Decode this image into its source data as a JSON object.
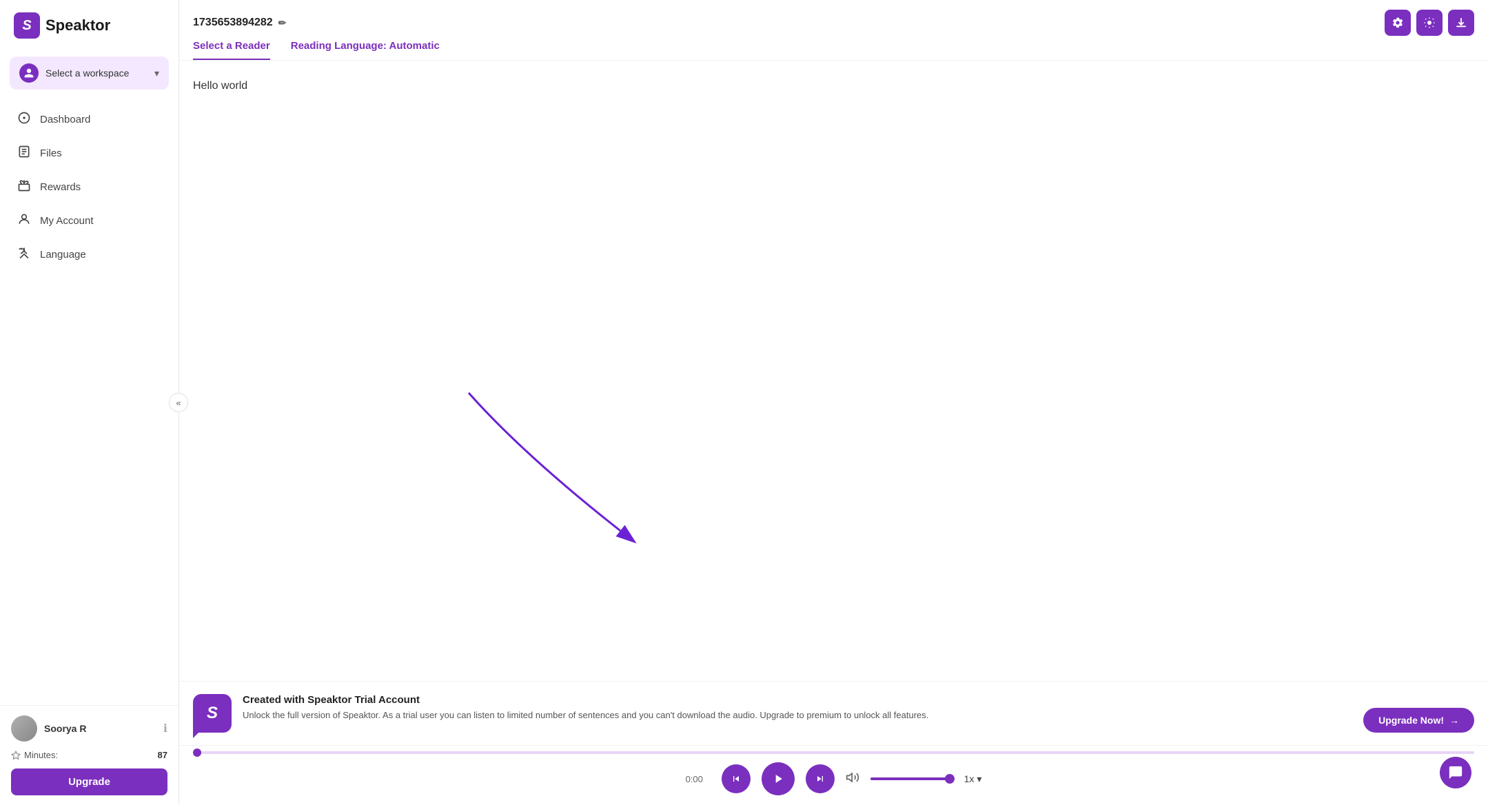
{
  "app": {
    "name": "Speaktor",
    "logo_letter": "S"
  },
  "sidebar": {
    "workspace": {
      "label": "Select a workspace",
      "chevron": "▾"
    },
    "nav": [
      {
        "id": "dashboard",
        "label": "Dashboard",
        "icon": "○"
      },
      {
        "id": "files",
        "label": "Files",
        "icon": "▦"
      },
      {
        "id": "rewards",
        "label": "Rewards",
        "icon": "⬛"
      },
      {
        "id": "my-account",
        "label": "My Account",
        "icon": "👤"
      },
      {
        "id": "language",
        "label": "Language",
        "icon": "✦"
      }
    ],
    "collapse_icon": "«",
    "user": {
      "name": "Soorya R",
      "info_icon": "ℹ",
      "minutes_label": "Minutes:",
      "minutes_value": "87",
      "upgrade_label": "Upgrade"
    }
  },
  "header": {
    "file_id": "1735653894282",
    "edit_icon": "✏",
    "tabs": [
      {
        "id": "select-reader",
        "label": "Select a Reader"
      },
      {
        "id": "reading-language",
        "label": "Reading Language: Automatic"
      }
    ],
    "actions": {
      "settings_icon": "⚙",
      "brightness_icon": "☀",
      "download_icon": "⬇"
    }
  },
  "content": {
    "text": "Hello world"
  },
  "trial": {
    "title": "Created with Speaktor Trial Account",
    "description": "Unlock the full version of Speaktor. As a trial user you can listen to limited number of sentences and you can't download the audio. Upgrade to premium to unlock all features.",
    "upgrade_label": "Upgrade Now!",
    "upgrade_icon": "→"
  },
  "player": {
    "time": "0:00",
    "prev_icon": "⏮",
    "play_icon": "▶",
    "next_icon": "⏭",
    "volume_icon": "🔊",
    "speed": "1x",
    "speed_chevron": "▾",
    "progress": 0
  },
  "chat": {
    "icon": "💬"
  }
}
